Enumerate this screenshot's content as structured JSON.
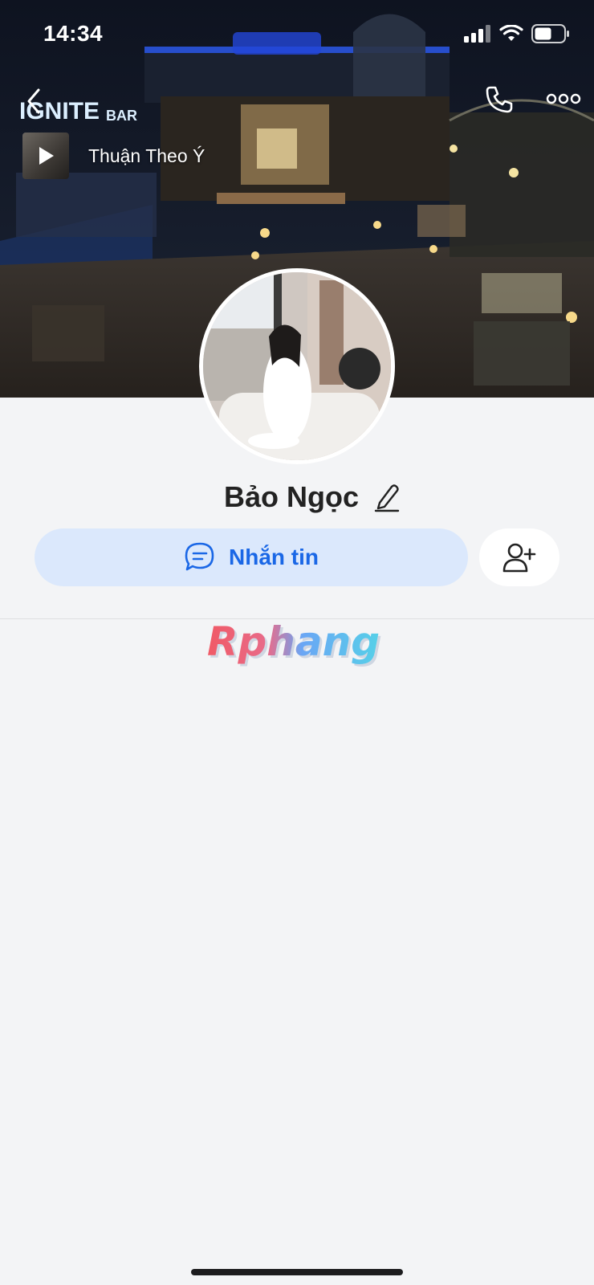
{
  "status_bar": {
    "time": "14:34",
    "icons": [
      "signal-icon",
      "wifi-icon",
      "battery-icon"
    ]
  },
  "header": {
    "back_icon": "chevron-left-icon",
    "call_icon": "phone-icon",
    "more_icon": "more-dots-icon"
  },
  "cover": {
    "sign_text": "IGNITE",
    "sign_suffix": "BAR"
  },
  "music": {
    "title": "Thuận Theo Ý",
    "play_icon": "play-icon"
  },
  "profile": {
    "name": "Bảo Ngọc",
    "edit_icon": "pencil-icon"
  },
  "actions": {
    "message_label": "Nhắn tin",
    "message_icon": "chat-bubble-icon",
    "add_friend_icon": "add-user-icon"
  },
  "watermark": {
    "text": "Rphang"
  },
  "colors": {
    "accent": "#1a67e6",
    "message_button_bg": "#dbe8fc",
    "page_bg": "#f3f4f6"
  }
}
